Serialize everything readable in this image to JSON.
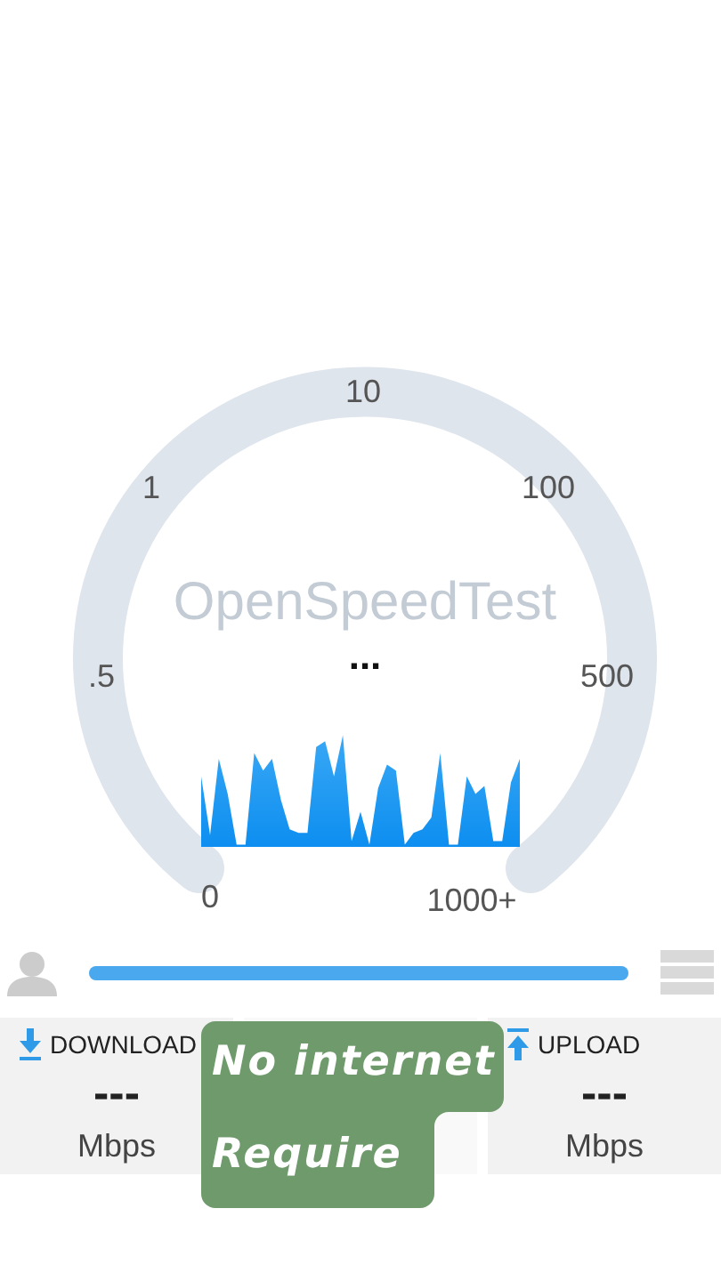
{
  "gauge": {
    "logo": "OpenSpeedTest",
    "ticks": [
      "0",
      ".5",
      "1",
      "10",
      "100",
      "500",
      "1000+"
    ],
    "status": "..."
  },
  "progress": {
    "level": 1.0
  },
  "stats": [
    {
      "kind": "download",
      "label": "DOWNLOAD",
      "value": "---",
      "unit": "Mbps"
    },
    {
      "kind": "ping"
    },
    {
      "kind": "upload",
      "label": "UPLOAD",
      "value": "---",
      "unit": "Mbps"
    }
  ],
  "caption": {
    "lines": [
      "No internet",
      "Require"
    ]
  }
}
